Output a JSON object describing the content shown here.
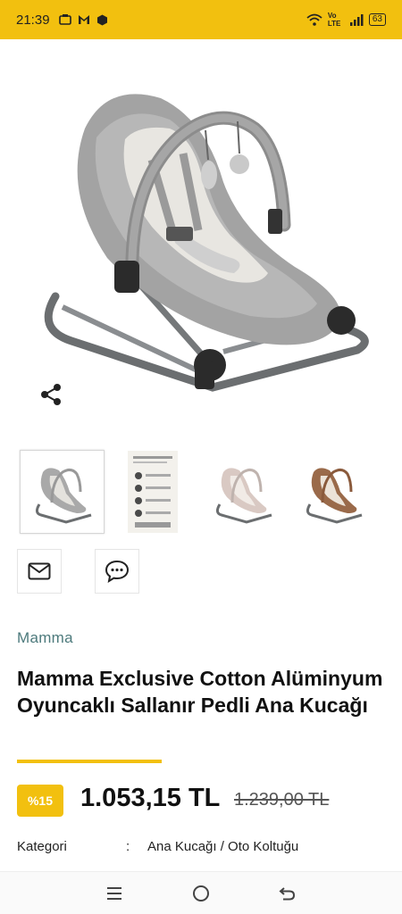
{
  "status_bar": {
    "time": "21:39",
    "network_label": "Vo LTE",
    "battery": "63",
    "icons": [
      "camera-icon",
      "mail-icon",
      "cube-icon",
      "wifi-icon",
      "signal-icon",
      "battery-icon"
    ]
  },
  "product": {
    "brand": "Mamma",
    "title": "Mamma Exclusive Cotton Alüminyum Oyuncaklı Sallanır Pedli Ana Kucağı",
    "discount_badge": "%15",
    "price": "1.053,15 TL",
    "old_price": "1.239,00 TL",
    "category_label": "Kategori",
    "category_separator": ":",
    "category_value": "Ana Kucağı / Oto Koltuğu"
  },
  "gallery": {
    "active_index": 0,
    "thumbnails": [
      "gray-rocker",
      "info-sheet",
      "pink-rocker",
      "brown-rocker"
    ]
  },
  "actions": [
    "mail-icon",
    "chat-icon",
    "share-icon"
  ],
  "nav": [
    "menu-icon",
    "home-circle-icon",
    "back-icon"
  ],
  "colors": {
    "accent": "#f2c00f",
    "brand_text": "#4d7a7c"
  }
}
